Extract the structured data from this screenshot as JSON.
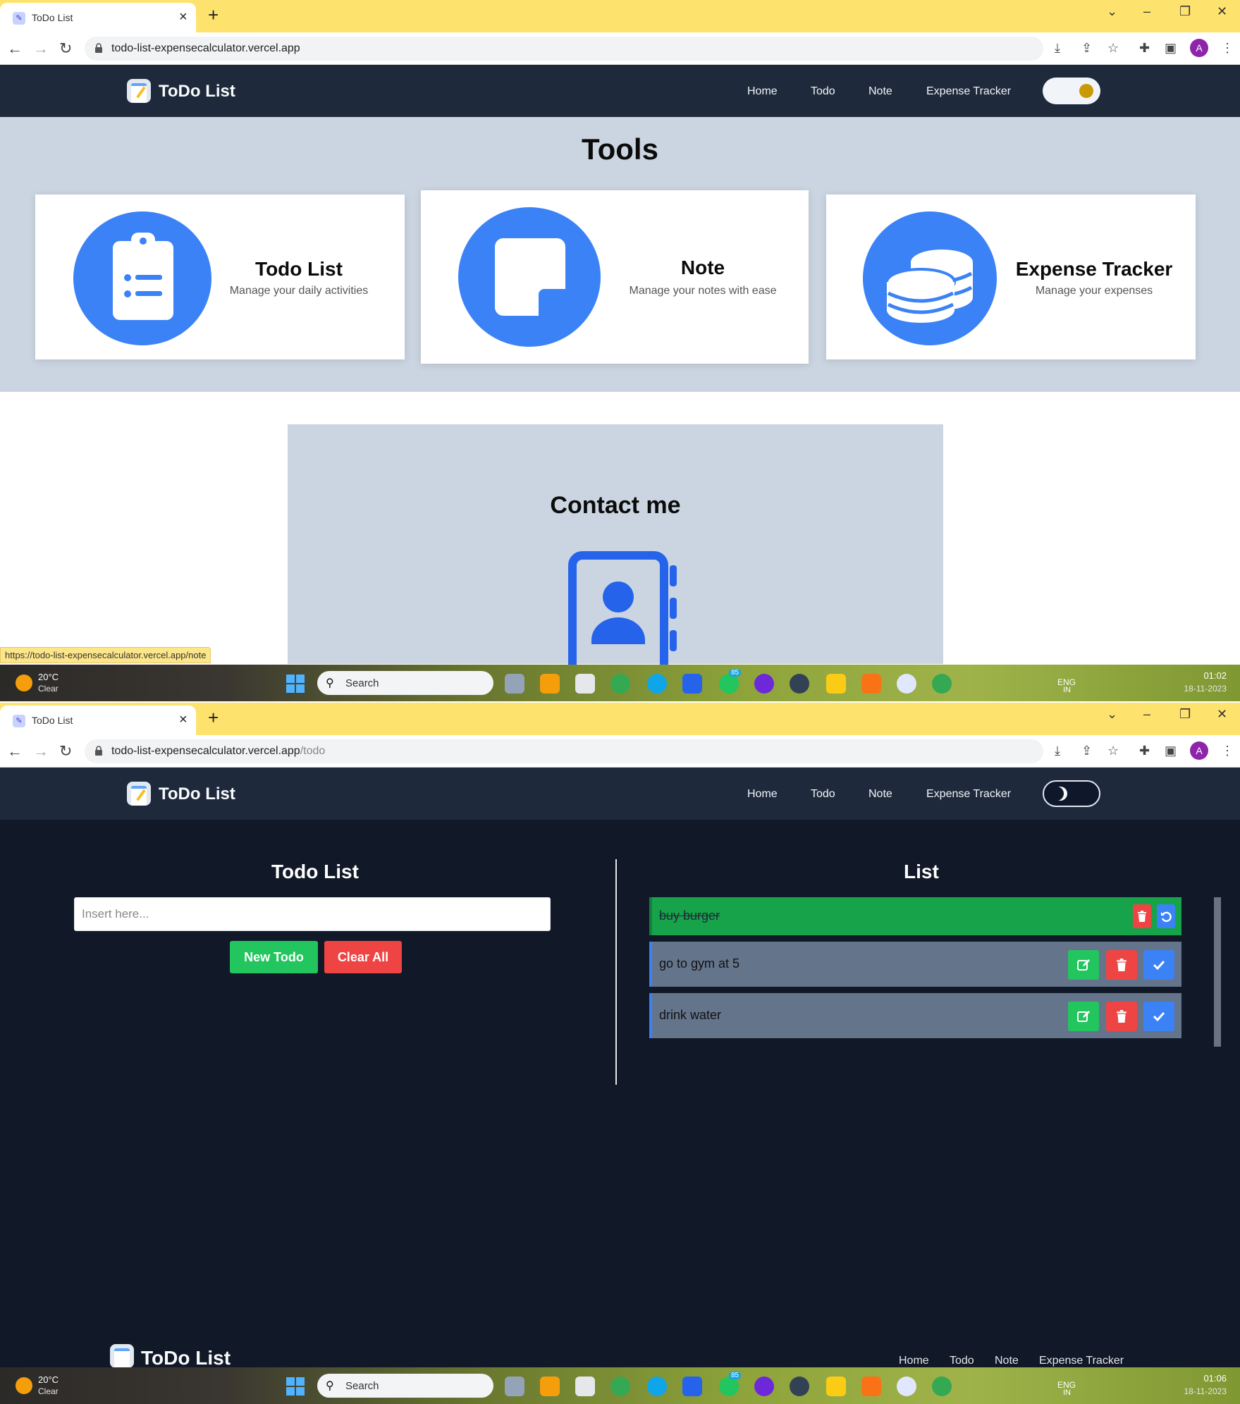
{
  "browser": {
    "tab_title": "ToDo List",
    "tab_close": "×",
    "new_tab": "+",
    "url_host": "todo-list-expensecalculator.vercel.app",
    "url_path_todo": "/todo",
    "profile_initial": "A"
  },
  "site": {
    "brand": "ToDo List",
    "nav": [
      "Home",
      "Todo",
      "Note",
      "Expense Tracker"
    ]
  },
  "home": {
    "tools_heading": "Tools",
    "cards": [
      {
        "title": "Todo List",
        "desc": "Manage your daily activities",
        "icon": "clipboard-list-icon"
      },
      {
        "title": "Note",
        "desc": "Manage your notes with ease",
        "icon": "sticky-note-icon"
      },
      {
        "title": "Expense Tracker",
        "desc": "Manage your expenses",
        "icon": "coins-icon"
      }
    ],
    "contact_heading": "Contact me",
    "status_url": "https://todo-list-expensecalculator.vercel.app/note"
  },
  "todo_page": {
    "left_heading": "Todo List",
    "input_placeholder": "Insert here...",
    "new_button": "New Todo",
    "clear_button": "Clear All",
    "right_heading": "List",
    "items": [
      {
        "text": "buy burger",
        "completed": true
      },
      {
        "text": "go to gym at 5",
        "completed": false
      },
      {
        "text": "drink water",
        "completed": false
      }
    ]
  },
  "footer": {
    "brand": "ToDo List",
    "links": [
      "Home",
      "Todo",
      "Note",
      "Expense Tracker"
    ]
  },
  "taskbar1": {
    "temp": "20°C",
    "condition": "Clear",
    "search": "Search",
    "lang": "ENG",
    "region": "IN",
    "time": "01:02",
    "date": "18-11-2023",
    "badge": "85"
  },
  "taskbar2": {
    "temp": "20°C",
    "condition": "Clear",
    "search": "Search",
    "lang": "ENG",
    "region": "IN",
    "time": "01:06",
    "date": "18-11-2023",
    "badge": "85"
  },
  "colors": {
    "accent_blue": "#3b82f6",
    "navbar": "#1e293b",
    "tools_bg": "#cbd5e1",
    "dark_bg": "#111827",
    "done_green": "#16a34a",
    "danger_red": "#ef4444",
    "tab_strip": "#fde36d"
  }
}
